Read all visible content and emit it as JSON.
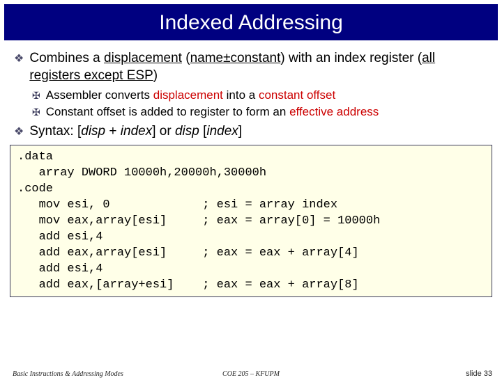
{
  "title": "Indexed Addressing",
  "bullets": [
    {
      "prefix": "Combines a ",
      "disp": "displacement",
      "paren": " (",
      "nameconst": "name±constant",
      "afterparen": ") with an index register (",
      "regs": "all registers except ESP",
      "close": ")",
      "subs": [
        {
          "t1": "Assembler converts ",
          "t2": "displacement",
          "t3": " into a ",
          "t4": "constant offset"
        },
        {
          "t1": "Constant offset is added to register to form an ",
          "t2": "effective address",
          "t3": "",
          "t4": ""
        }
      ]
    },
    {
      "plain1": "Syntax: [",
      "it1": "disp",
      "plain2": " + ",
      "it2": "index",
      "plain3": "] or ",
      "it3": "disp",
      "plain4": " [",
      "it4": "index",
      "plain5": "]"
    }
  ],
  "code": ".data\n   array DWORD 10000h,20000h,30000h\n.code\n   mov esi, 0             ; esi = array index\n   mov eax,array[esi]     ; eax = array[0] = 10000h\n   add esi,4\n   add eax,array[esi]     ; eax = eax + array[4]\n   add esi,4\n   add eax,[array+esi]    ; eax = eax + array[8]",
  "footer": {
    "left": "Basic Instructions & Addressing Modes",
    "center": "COE 205 – KFUPM",
    "right": "slide 33"
  }
}
